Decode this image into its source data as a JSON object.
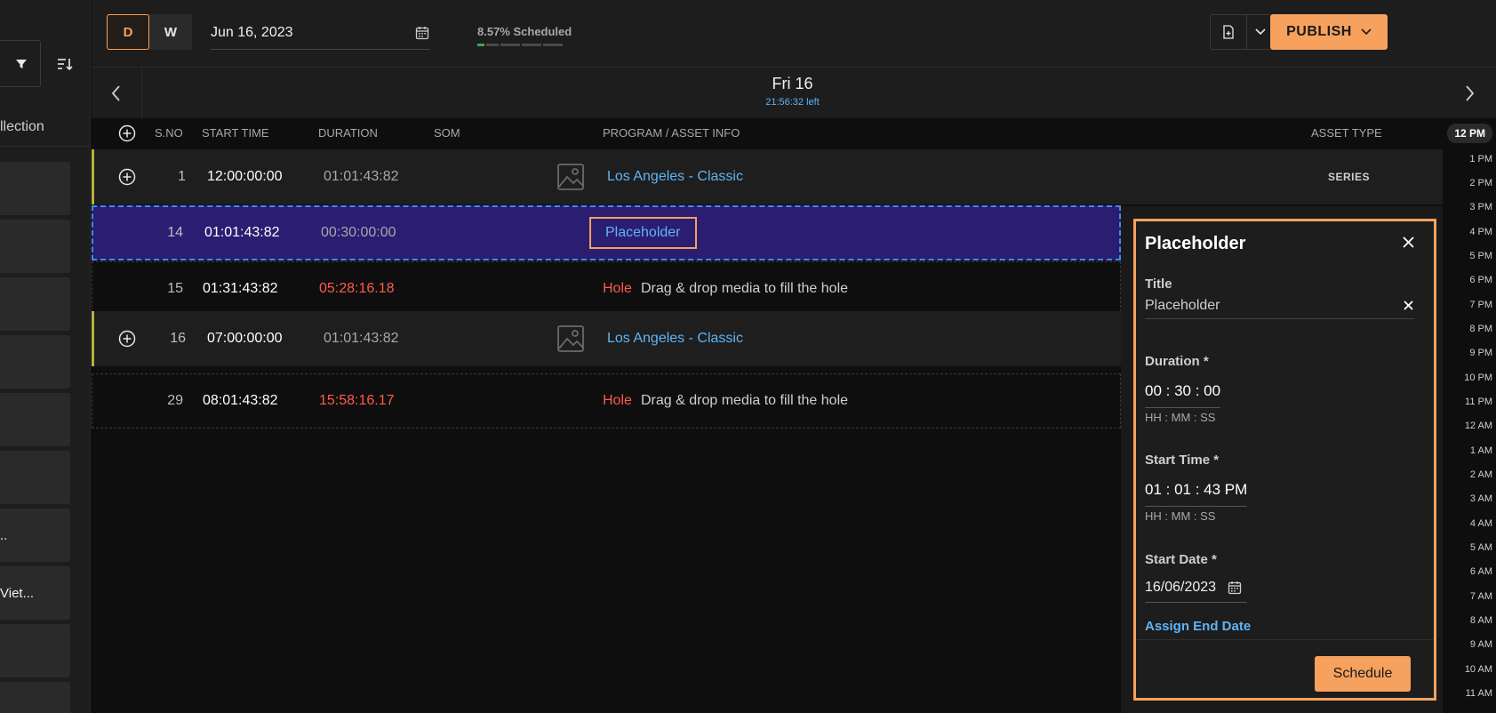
{
  "sidebar": {
    "collection_label": "llection",
    "cards": [
      "",
      "",
      "",
      "",
      "",
      "",
      "..",
      "Viet...",
      "",
      ""
    ]
  },
  "topbar": {
    "view_day": "D",
    "view_week": "W",
    "date_value": "Jun 16, 2023",
    "scheduled_label": "8.57% Scheduled",
    "scheduled_percent": 8.57,
    "publish_label": "PUBLISH"
  },
  "day": {
    "title": "Fri 16",
    "time_left": "21:56:32 left"
  },
  "table": {
    "headers": {
      "sno": "S.NO",
      "start_time": "START TIME",
      "duration": "DURATION",
      "som": "SOM",
      "program": "PROGRAM / ASSET INFO",
      "asset_type": "ASSET TYPE"
    },
    "rows": [
      {
        "sno": "1",
        "start": "12:00:00:00",
        "duration": "01:01:43:82",
        "title": "Los Angeles - Classic",
        "type": "SERIES"
      },
      {
        "sno": "14",
        "start": "01:01:43:82",
        "duration": "00:30:00:00",
        "title": "Placeholder"
      },
      {
        "sno": "15",
        "start": "01:31:43:82",
        "duration": "05:28:16.18",
        "hole_label": "Hole",
        "hole_text": "Drag & drop media to fill the hole"
      },
      {
        "sno": "16",
        "start": "07:00:00:00",
        "duration": "01:01:43:82",
        "title": "Los Angeles - Classic"
      },
      {
        "sno": "29",
        "start": "08:01:43:82",
        "duration": "15:58:16.17",
        "hole_label": "Hole",
        "hole_text": "Drag & drop media to fill the hole"
      }
    ]
  },
  "rail": {
    "now": "12 PM",
    "hours": [
      "1 PM",
      "2 PM",
      "3 PM",
      "4 PM",
      "5 PM",
      "6 PM",
      "7 PM",
      "8 PM",
      "9 PM",
      "10 PM",
      "11 PM",
      "12 AM",
      "1 AM",
      "2 AM",
      "3 AM",
      "4 AM",
      "5 AM",
      "6 AM",
      "7 AM",
      "8 AM",
      "9 AM",
      "10 AM",
      "11 AM"
    ]
  },
  "panel": {
    "title": "Placeholder",
    "title_label": "Title",
    "title_value": "Placeholder",
    "duration_label": "Duration *",
    "duration_value": "00 : 30 : 00",
    "duration_hint": "HH : MM : SS",
    "start_time_label": "Start Time *",
    "start_time_value": "01 : 01 : 43 PM",
    "start_time_hint": "HH : MM : SS",
    "start_date_label": "Start Date *",
    "start_date_value": "16/06/2023",
    "assign_end_date": "Assign End Date",
    "schedule_button": "Schedule"
  },
  "colors": {
    "accent": "#f6a15d",
    "link": "#5fb4f5",
    "selected_row": "#2a1d72",
    "error": "#ff5a4f"
  }
}
